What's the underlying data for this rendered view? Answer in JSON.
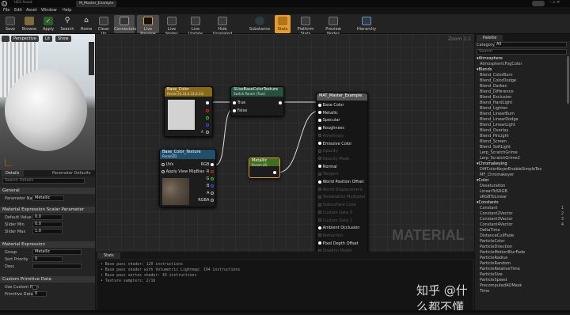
{
  "window": {
    "title": "M_Master_Example",
    "tab_aux": "UE4 Asset"
  },
  "menu": [
    "File",
    "Edit",
    "Asset",
    "Window",
    "Help"
  ],
  "toolbar": [
    {
      "label": "Save",
      "color": "#3c3c3c"
    },
    {
      "label": "Browse",
      "color": "#3c3c3c"
    },
    {
      "label": "Apply",
      "color": "#3c3c3c"
    },
    {
      "label": "Search",
      "color": "#3c3c3c"
    },
    {
      "label": "Home",
      "color": "#3c3c3c"
    },
    {
      "label": "Clean Up",
      "color": "#3c3c3c"
    },
    {
      "label": "Connectors",
      "color": "#3c3c3c"
    },
    {
      "label": "Live Preview",
      "color": "#3c3c3c"
    },
    {
      "label": "Live Nodes",
      "color": "#3c3c3c"
    },
    {
      "label": "Live Update",
      "color": "#3c3c3c"
    },
    {
      "label": "Hide Unrelated",
      "color": "#3c3c3c"
    },
    {
      "label": "Substance",
      "color": "#3c3c3c"
    },
    {
      "label": "Stats",
      "color": "#e39c2d"
    },
    {
      "label": "Platform Stats",
      "color": "#3c3c3c"
    },
    {
      "label": "Preview Nodes",
      "color": "#3c3c3c"
    },
    {
      "label": "Hierarchy",
      "color": "#3c3c3c"
    }
  ],
  "viewport": {
    "buttons": [
      "Perspective",
      "Lit",
      "Show"
    ]
  },
  "details": {
    "tabs": [
      "Details",
      "Parameter Defaults"
    ],
    "search_placeholder": "Search Details",
    "general": "General",
    "param_name_label": "Parameter Name",
    "param_name_value": "Metallic",
    "scalar_section": "Material Expression Scalar Parameter",
    "rows": [
      {
        "label": "Default Value",
        "value": "0.0"
      },
      {
        "label": "Slider Min",
        "value": "0.0"
      },
      {
        "label": "Slider Max",
        "value": "1.0"
      }
    ],
    "expr_section": "Material Expression",
    "group_label": "Group",
    "group_value": "Metallic",
    "sort_label": "Sort Priority",
    "sort_value": "0",
    "desc_label": "Desc",
    "prim_section": "Custom Primitive Data",
    "use_prim_label": "Use Custom Prim",
    "prim_index_label": "Primitive Data Ind",
    "prim_index_value": "0"
  },
  "graph": {
    "zoom": "Zoom 1:1",
    "watermark": "MATERIAL",
    "nodes": {
      "base_color": {
        "title": "Base_Color",
        "subtitle": "Param (0.33,0.33,0.33)",
        "pins": [
          "A"
        ]
      },
      "switch": {
        "title": "SUseBaseColorTexture",
        "subtitle": "Switch Param (True)",
        "pins": [
          "True",
          "False"
        ]
      },
      "master": {
        "title": "MAT_Master_Example",
        "pins": [
          "Base Color",
          "Metallic",
          "Specular",
          "Roughness",
          "Anisotropy",
          "Emissive Color",
          "Opacity",
          "Opacity Mask",
          "Normal",
          "Tangent",
          "World Position Offset",
          "World Displacement",
          "Tessellation Multiplier",
          "Subsurface Color",
          "Custom Data 0",
          "Custom Data 1",
          "Ambient Occlusion",
          "Refraction",
          "Pixel Depth Offset",
          "Shading Model"
        ]
      },
      "texture": {
        "title": "Base_Color_Texture",
        "subtitle": "Param2D",
        "inputs": [
          "UVs",
          "Apply View MipBias"
        ],
        "outputs": [
          "RGB",
          "R",
          "G",
          "B",
          "A",
          "RGBA"
        ]
      },
      "metallic": {
        "title": "Metallic",
        "subtitle": "Param (0)"
      }
    }
  },
  "stats": {
    "tab": "Stats",
    "lines": [
      "Base pass shader: 120 instructions",
      "Base pass shader with Volumetric Lightmap: 194 instructions",
      "Base pass vertex shader: 43 instructions",
      "Texture samplers: 2/16"
    ]
  },
  "palette": {
    "tab": "Palette",
    "category_label": "Category",
    "category_value": "All",
    "search_placeholder": "Search",
    "items": [
      {
        "t": "Atmosphere",
        "c": true
      },
      {
        "t": "AtmosphericFogColor"
      },
      {
        "t": "Blends",
        "c": true
      },
      {
        "t": "Blend_ColorBurn"
      },
      {
        "t": "Blend_ColorDodge"
      },
      {
        "t": "Blend_Darken"
      },
      {
        "t": "Blend_Difference"
      },
      {
        "t": "Blend_Exclusion"
      },
      {
        "t": "Blend_HardLight"
      },
      {
        "t": "Blend_Lighten"
      },
      {
        "t": "Blend_LinearBurn"
      },
      {
        "t": "Blend_LinearDodge"
      },
      {
        "t": "Blend_LinearLight"
      },
      {
        "t": "Blend_Overlay"
      },
      {
        "t": "Blend_PinLight"
      },
      {
        "t": "Blend_Screen"
      },
      {
        "t": "Blend_SoftLight"
      },
      {
        "t": "Lerp_ScratchGrime"
      },
      {
        "t": "Lerp_ScratchGrime2"
      },
      {
        "t": "Chromakeying",
        "c": true
      },
      {
        "t": "DiffColorKeyerEnableSimpleTex"
      },
      {
        "t": "MF_Chromakeyer"
      },
      {
        "t": "Color",
        "c": true
      },
      {
        "t": "Desaturation"
      },
      {
        "t": "LinearToSRGB"
      },
      {
        "t": "sRGBToLinear"
      },
      {
        "t": "Constants",
        "c": true
      },
      {
        "t": "Constant",
        "v": "1"
      },
      {
        "t": "Constant2Vector",
        "v": "2"
      },
      {
        "t": "Constant3Vector",
        "v": "3"
      },
      {
        "t": "Constant4Vector",
        "v": "4"
      },
      {
        "t": "DeltaTime"
      },
      {
        "t": "DistanceCullFade"
      },
      {
        "t": "ParticleColor"
      },
      {
        "t": "ParticleDirection"
      },
      {
        "t": "ParticleMotionBlurFade"
      },
      {
        "t": "ParticleRadius"
      },
      {
        "t": "ParticleRandom"
      },
      {
        "t": "ParticleRelativeTime"
      },
      {
        "t": "ParticleSize"
      },
      {
        "t": "ParticleSpeed"
      },
      {
        "t": "PrecomputedAOMask"
      },
      {
        "t": "Time"
      }
    ]
  },
  "watermark_text": "知乎 @什么都不懂"
}
